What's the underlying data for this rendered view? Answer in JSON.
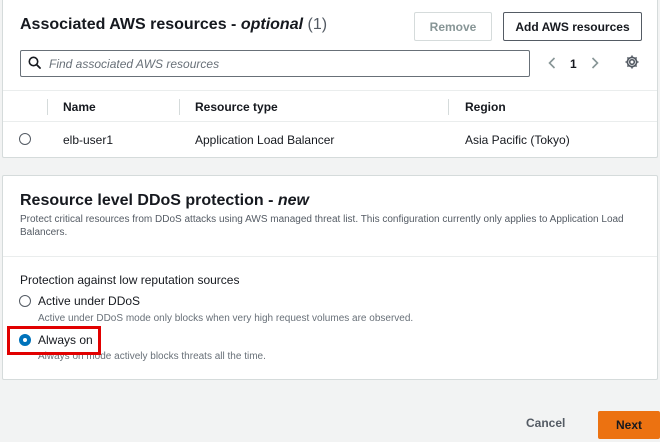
{
  "associated": {
    "title": "Associated AWS resources - ",
    "title_emphasis": "optional",
    "count": "(1)",
    "remove_label": "Remove",
    "add_label": "Add AWS resources",
    "search_placeholder": "Find associated AWS resources",
    "page": "1",
    "columns": [
      "Name",
      "Resource type",
      "Region"
    ],
    "rows": [
      {
        "name": "elb-user1",
        "type": "Application Load Balancer",
        "region": "Asia Pacific (Tokyo)"
      }
    ]
  },
  "ddos": {
    "title": "Resource level DDoS protection - ",
    "title_emphasis": "new",
    "description": "Protect critical resources from DDoS attacks using AWS managed threat list. This configuration currently only applies to Application Load Balancers.",
    "field_label": "Protection against low reputation sources",
    "options": [
      {
        "label": "Active under DDoS",
        "description": "Active under DDoS mode only blocks when very high request volumes are observed.",
        "selected": false
      },
      {
        "label": "Always on",
        "description": "Always on mode actively blocks threats all the time.",
        "selected": true
      }
    ]
  },
  "footer": {
    "cancel_label": "Cancel",
    "next_label": "Next"
  },
  "colors": {
    "accent": "#ec7211",
    "radio_selected": "#0073bb",
    "highlight": "#e10000"
  },
  "icons": {
    "search": "search-icon",
    "prev": "chevron-left-icon",
    "next": "chevron-right-icon",
    "settings": "gear-icon"
  }
}
